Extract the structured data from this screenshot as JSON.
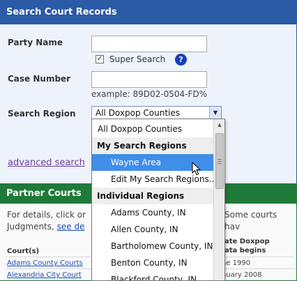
{
  "search_panel": {
    "title": "Search Court Records",
    "party_name_label": "Party Name",
    "party_name_value": "",
    "super_search_label": "Super Search",
    "super_search_checked": true,
    "help_glyph": "?",
    "case_number_label": "Case Number",
    "case_number_value": "",
    "case_example": "example: 89D02-0504-FD%",
    "region_label": "Search Region",
    "region_selected": "All Doxpop Counties",
    "advanced_search_label": "advanced search"
  },
  "region_dropdown": {
    "options": [
      {
        "kind": "item",
        "label": "All Doxpop Counties"
      },
      {
        "kind": "group",
        "label": "My Search Regions"
      },
      {
        "kind": "child",
        "label": "Wayne Area",
        "selected": true
      },
      {
        "kind": "plain",
        "label": "Edit My Search Regions..."
      },
      {
        "kind": "group",
        "label": "Individual Regions"
      },
      {
        "kind": "child",
        "label": "Adams County, IN"
      },
      {
        "kind": "child",
        "label": "Allen County, IN"
      },
      {
        "kind": "child",
        "label": "Bartholomew County, IN"
      },
      {
        "kind": "child",
        "label": "Benton County, IN"
      },
      {
        "kind": "child",
        "label": "Blackford County, IN"
      }
    ]
  },
  "partner_courts": {
    "title": "Partner Courts",
    "intro_start": "For details, click or",
    "intro_end": "Some courts hav",
    "intro_line2": "Judgments,",
    "intro_link": "see de",
    "col_courts": "Court(s)",
    "col_date_line1": "ate Doxpop",
    "col_date_line2": "ata begins",
    "rows": [
      {
        "court": "Adams County Courts",
        "date": "ne 1990"
      },
      {
        "court": "Alexandria City Court",
        "date": "nuary 2008"
      }
    ]
  },
  "colors": {
    "search_header": "#2b5aa6",
    "partner_header": "#1f7a3a",
    "selected_option": "#3f8ee8",
    "help_icon": "#1a3fb8"
  },
  "icons": {
    "help": "question-circle-icon",
    "dropdown_arrow": "chevron-down-icon",
    "cursor": "mouse-pointer-icon"
  }
}
